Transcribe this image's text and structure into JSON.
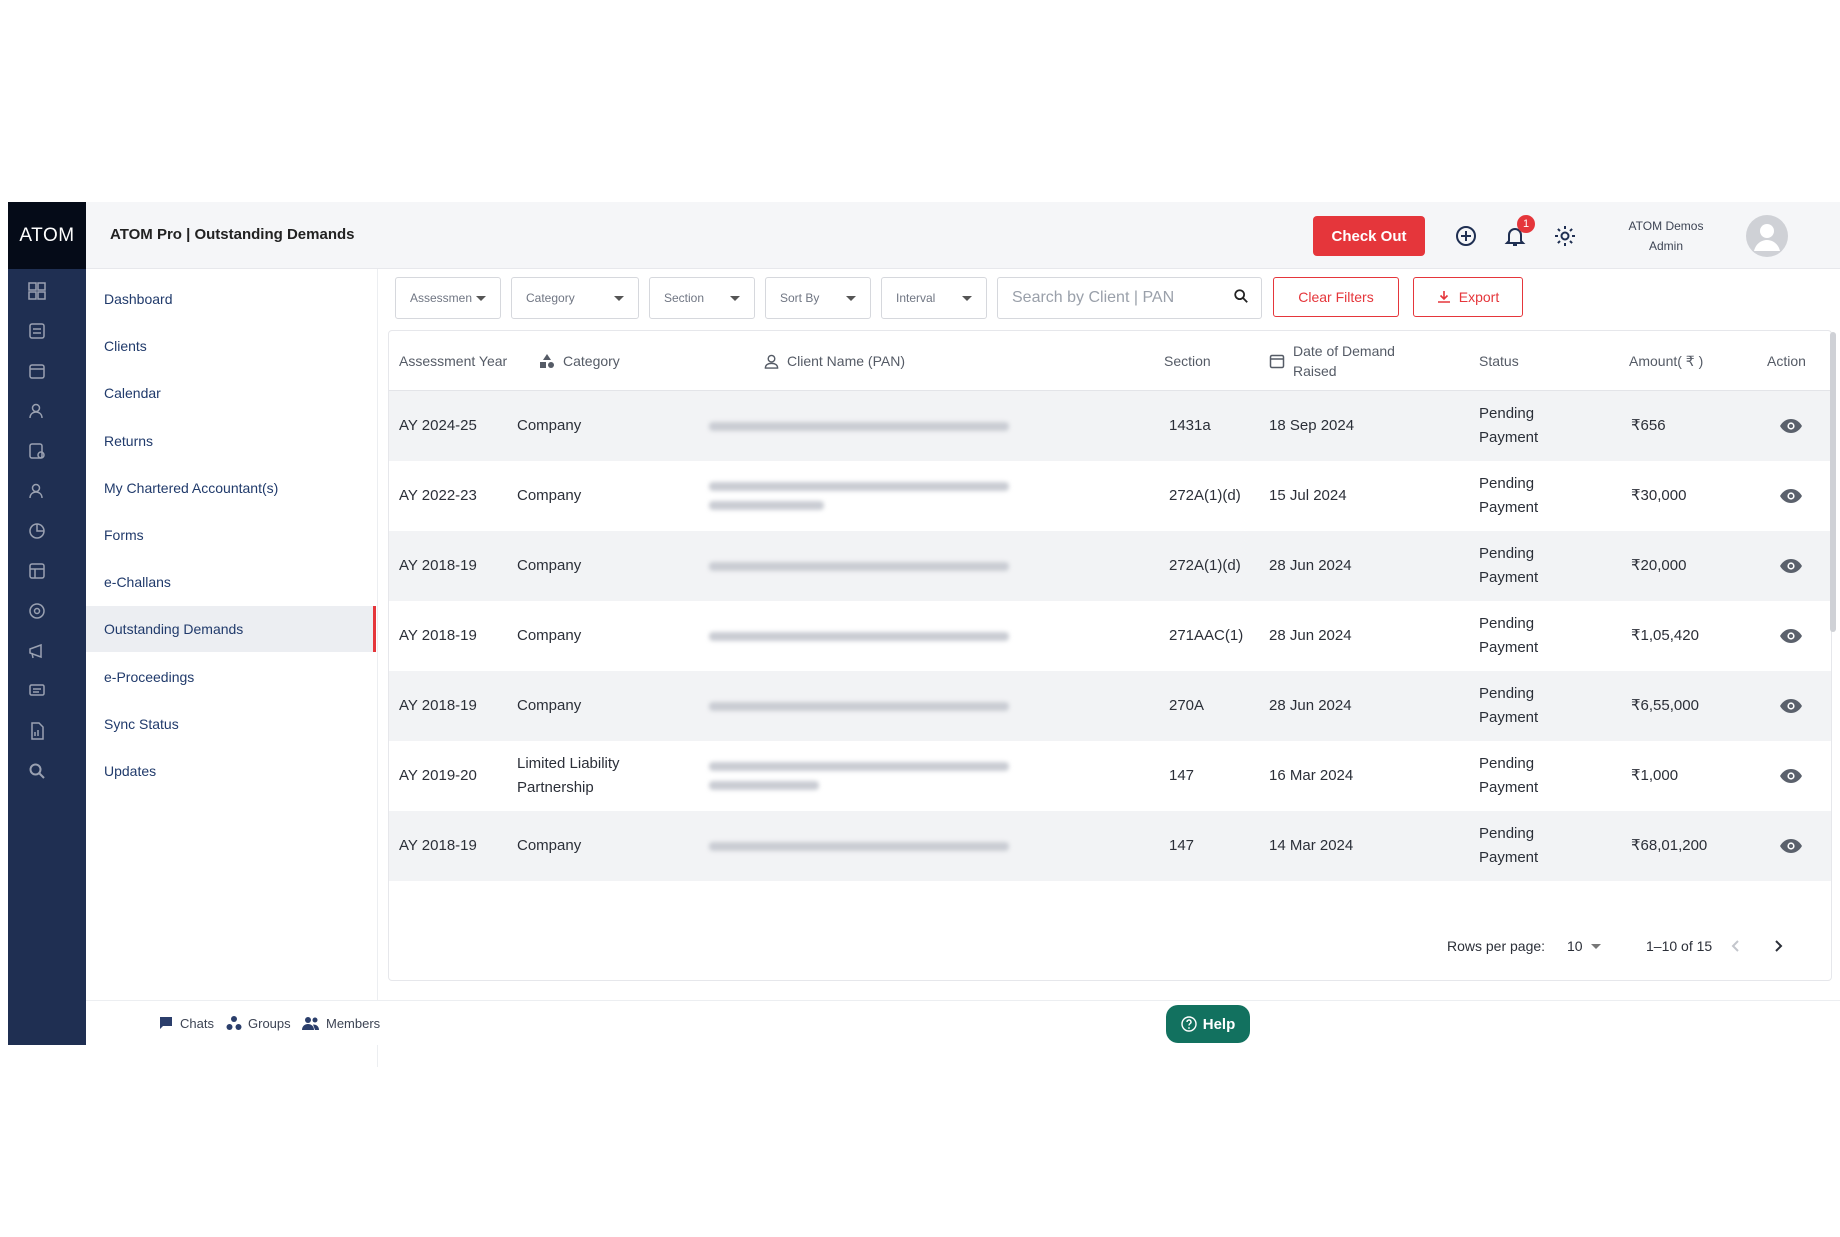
{
  "brand": "ATOM",
  "header": {
    "title": "ATOM Pro | Outstanding Demands",
    "checkout_label": "Check Out",
    "notification_count": "1",
    "user_name": "ATOM Demos",
    "user_role": "Admin"
  },
  "sidebar": {
    "items": [
      {
        "label": "Dashboard"
      },
      {
        "label": "Clients"
      },
      {
        "label": "Calendar"
      },
      {
        "label": "Returns"
      },
      {
        "label": "My Chartered Accountant(s)"
      },
      {
        "label": "Forms"
      },
      {
        "label": "e-Challans"
      },
      {
        "label": "Outstanding Demands"
      },
      {
        "label": "e-Proceedings"
      },
      {
        "label": "Sync Status"
      },
      {
        "label": "Updates"
      }
    ],
    "active_index": 7
  },
  "toolbar": {
    "filters": [
      {
        "label": "Assessmen"
      },
      {
        "label": "Category"
      },
      {
        "label": "Section"
      },
      {
        "label": "Sort By"
      },
      {
        "label": "Interval"
      }
    ],
    "search_placeholder": "Search by Client | PAN",
    "clear_filters_label": "Clear Filters",
    "export_label": "Export"
  },
  "table": {
    "columns": {
      "assessment_year": "Assessment Year",
      "category": "Category",
      "client_name": "Client Name (PAN)",
      "section": "Section",
      "date_raised": "Date of Demand Raised",
      "status": "Status",
      "amount": "Amount( ₹ )",
      "action": "Action"
    },
    "rows": [
      {
        "ay": "AY 2024-25",
        "category": "Company",
        "client_lines": 1,
        "section": "1431a",
        "date": "18 Sep 2024",
        "status": "Pending Payment",
        "amount": "₹656"
      },
      {
        "ay": "AY 2022-23",
        "category": "Company",
        "client_lines": 2,
        "section": "272A(1)(d)",
        "date": "15 Jul 2024",
        "status": "Pending Payment",
        "amount": "₹30,000"
      },
      {
        "ay": "AY 2018-19",
        "category": "Company",
        "client_lines": 1,
        "section": "272A(1)(d)",
        "date": "28 Jun 2024",
        "status": "Pending Payment",
        "amount": "₹20,000"
      },
      {
        "ay": "AY 2018-19",
        "category": "Company",
        "client_lines": 1,
        "section": "271AAC(1)",
        "date": "28 Jun 2024",
        "status": "Pending Payment",
        "amount": "₹1,05,420"
      },
      {
        "ay": "AY 2018-19",
        "category": "Company",
        "client_lines": 1,
        "section": "270A",
        "date": "28 Jun 2024",
        "status": "Pending Payment",
        "amount": "₹6,55,000"
      },
      {
        "ay": "AY 2019-20",
        "category": "Limited Liability Partnership",
        "client_lines": 2,
        "section": "147",
        "date": "16 Mar 2024",
        "status": "Pending Payment",
        "amount": "₹1,000"
      },
      {
        "ay": "AY 2018-19",
        "category": "Company",
        "client_lines": 1,
        "section": "147",
        "date": "14 Mar 2024",
        "status": "Pending Payment",
        "amount": "₹68,01,200"
      }
    ]
  },
  "pagination": {
    "rows_per_page_label": "Rows per page:",
    "rows_per_page": "10",
    "range": "1–10 of 15"
  },
  "footer": {
    "chats_label": "Chats",
    "groups_label": "Groups",
    "members_label": "Members",
    "help_label": "Help"
  },
  "colors": {
    "rail": "#1f2f52",
    "brand_bg": "#050b18",
    "accent_red": "#e5363b",
    "help_green": "#12715f",
    "link_blue": "#203a6b"
  }
}
